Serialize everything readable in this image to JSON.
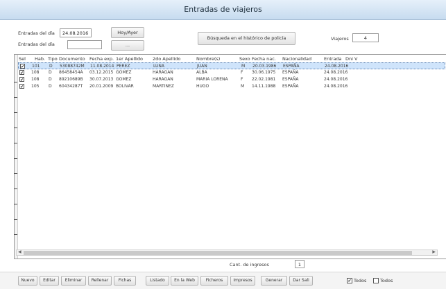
{
  "window": {
    "title": "Entradas de viajeros"
  },
  "filters": {
    "entradas_label": "Entradas del día",
    "entradas_value": "24.08.2016",
    "hoy_button": "Hoy/Ayer",
    "reservas_label": "Entradas del día",
    "reservas_value": "",
    "reservas_button": "...",
    "historico_button": "Búsqueda en el histórico de policía",
    "viajeros_label": "Viajeros",
    "viajeros_value": "4"
  },
  "grid": {
    "columns": [
      "Sel",
      "Hab.",
      "Tipo",
      "Documento",
      "Fecha exp.",
      "1er Apellido",
      "2do Apellido",
      "Nombre(s)",
      "Sexo",
      "Fecha nac.",
      "Nacionalidad",
      "Entrada",
      "Dni V"
    ],
    "rows": [
      {
        "checked": true,
        "hab": "101",
        "tipo": "D",
        "doc": "53088742M",
        "fexp": "11.08.2014",
        "ap1": "PEREZ",
        "ap2": "LUNA",
        "nombre": "JUAN",
        "sexo": "M",
        "fnac": "20.03.1986",
        "nac": "ESPAÑA",
        "entrada": "24.08.2016",
        "selected": true
      },
      {
        "checked": true,
        "hab": "108",
        "tipo": "D",
        "doc": "86458454A",
        "fexp": "03.12.2015",
        "ap1": "GOMEZ",
        "ap2": "HARAGAN",
        "nombre": "ALBA",
        "sexo": "F",
        "fnac": "30.06.1975",
        "nac": "ESPAÑA",
        "entrada": "24.08.2016",
        "selected": false
      },
      {
        "checked": true,
        "hab": "108",
        "tipo": "D",
        "doc": "89210689B",
        "fexp": "30.07.2013",
        "ap1": "GOMEZ",
        "ap2": "HARAGAN",
        "nombre": "MARIA LORENA",
        "sexo": "F",
        "fnac": "22.02.1981",
        "nac": "ESPAÑA",
        "entrada": "24.08.2016",
        "selected": false
      },
      {
        "checked": true,
        "hab": "105",
        "tipo": "D",
        "doc": "60434287T",
        "fexp": "20.01.2009",
        "ap1": "BOLIVAR",
        "ap2": "MARTINEZ",
        "nombre": "HUGO",
        "sexo": "M",
        "fnac": "14.11.1988",
        "nac": "ESPAÑA",
        "entrada": "24.08.2016",
        "selected": false
      }
    ]
  },
  "footer": {
    "copias_label": "Cant. de ingresos",
    "copias_value": "1",
    "buttons": [
      "Nuevo",
      "Editar",
      "Eliminar",
      "Rellenar",
      "Fichas",
      "Listado",
      "En la Web",
      "Ficheros",
      "Impresos",
      "Generar",
      "Dar Sali",
      "Todos",
      "Todos"
    ]
  },
  "colors": {
    "title_bg": "#c6dbef",
    "selected_row": "#cfe4fb"
  }
}
